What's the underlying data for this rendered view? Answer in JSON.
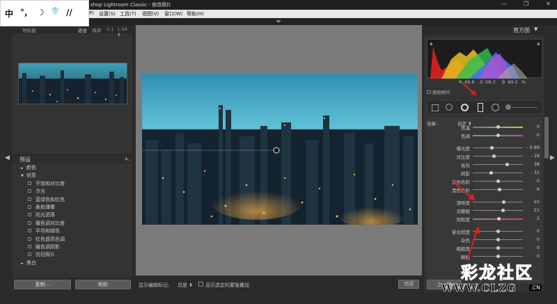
{
  "window": {
    "title": "shop Lightroom Classic - 修改照片",
    "controls": [
      "—",
      "❐",
      "✕"
    ]
  },
  "menu": [
    "P)",
    "设置(S)",
    "工具(T)",
    "视图(V)",
    "窗口(W)",
    "帮助(H)"
  ],
  "ime": {
    "items": [
      "中",
      "°,",
      "☽",
      "👕",
      "//"
    ]
  },
  "navigator": {
    "title": "导航器",
    "zoom_options": [
      "适合",
      "填满",
      "1:1",
      "1:16 ⬍"
    ]
  },
  "presets": {
    "title": "预设",
    "add": "+.",
    "items": [
      {
        "label": "颜色",
        "level": 0,
        "arrow": "►"
      },
      {
        "label": "创意",
        "level": 0,
        "arrow": "▼"
      },
      {
        "label": "不饱和对比度",
        "level": 1
      },
      {
        "label": "冷光",
        "level": 1
      },
      {
        "label": "蓝绿色和红色",
        "level": 1
      },
      {
        "label": "柔和薄雾",
        "level": 1
      },
      {
        "label": "阳光洒落",
        "level": 1
      },
      {
        "label": "暖色调对比度",
        "level": 1
      },
      {
        "label": "平坦和绿色",
        "level": 1
      },
      {
        "label": "红色提高色调",
        "level": 1
      },
      {
        "label": "暖色调阴影",
        "level": 1
      },
      {
        "label": "仿旧照片",
        "level": 1
      },
      {
        "label": "黑白",
        "level": 0,
        "arrow": "►"
      }
    ],
    "copy_button": "复制...",
    "paste_button": "粘贴"
  },
  "toolbar": {
    "show_edit_pins": "显示编辑标记:",
    "pins_value": "总是 ⬍",
    "show_overlay": "显示选定的蒙版叠加",
    "done": "完成"
  },
  "histogram": {
    "title": "直方图",
    "r_label": "R",
    "r_value": "48.8",
    "g_label": "G",
    "g_value": "58.3",
    "b_label": "B",
    "b_value": "69.2",
    "percent": "%",
    "original_photo": "原始照片"
  },
  "adjustments": {
    "effect_label": "效果:",
    "effect_value": "自定 ⬍",
    "sliders": [
      {
        "label": "色温",
        "value": "0",
        "pos": 0.5
      },
      {
        "label": "色调",
        "value": "0",
        "pos": 0.5
      },
      {
        "label": "曝光度",
        "value": "- 0.89",
        "pos": 0.38
      },
      {
        "label": "对比度",
        "value": "- 19",
        "pos": 0.42
      },
      {
        "label": "高光",
        "value": "38",
        "pos": 0.68
      },
      {
        "label": "阴影",
        "value": "- 31",
        "pos": 0.36
      },
      {
        "label": "白色色阶",
        "value": "0",
        "pos": 0.5
      },
      {
        "label": "黑色色阶",
        "value": "6",
        "pos": 0.53
      },
      {
        "label": "清晰度",
        "value": "22",
        "pos": 0.61
      },
      {
        "label": "去朦胧",
        "value": "21",
        "pos": 0.6
      },
      {
        "label": "饱和度",
        "value": "2",
        "pos": 0.51
      },
      {
        "label": "晕化程度",
        "value": "0",
        "pos": 0.5
      },
      {
        "label": "杂色",
        "value": "0",
        "pos": 0.5
      },
      {
        "label": "粗糙度",
        "value": "0",
        "pos": 0.5
      },
      {
        "label": "颗粒",
        "value": "0",
        "pos": 0.5
      }
    ],
    "reset_button": "上一张"
  },
  "watermark": {
    "line1": "彩龙社区",
    "line2": "WWW.CLZG",
    "suffix": ".CN"
  }
}
